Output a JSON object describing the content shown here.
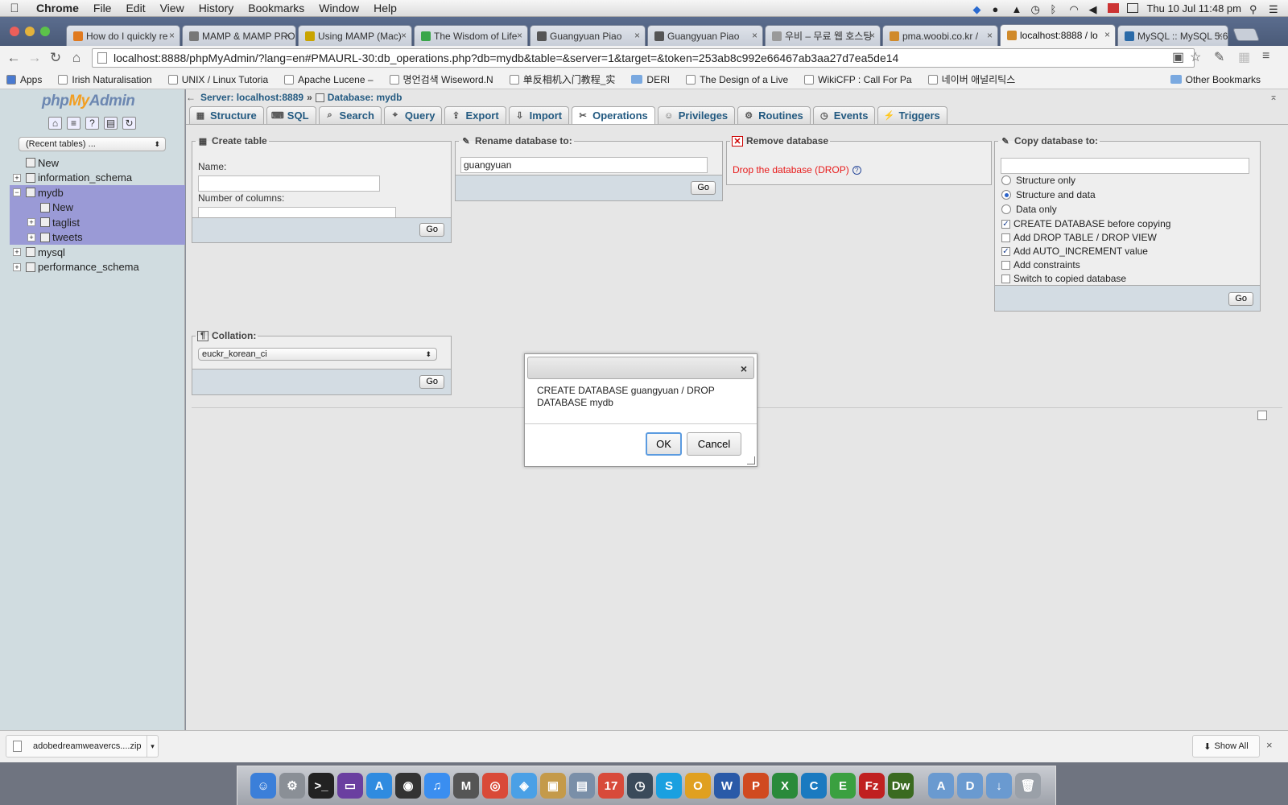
{
  "menubar": {
    "items": [
      "Chrome",
      "File",
      "Edit",
      "View",
      "History",
      "Bookmarks",
      "Window",
      "Help"
    ],
    "clock": "Thu 10 Jul  11:48 pm"
  },
  "tabs": [
    {
      "label": "How do I quickly re",
      "fav": "#e07a1f"
    },
    {
      "label": "MAMP & MAMP PRO",
      "fav": "#777"
    },
    {
      "label": "Using MAMP (Mac)",
      "fav": "#c9a400"
    },
    {
      "label": "The Wisdom of Life",
      "fav": "#3aa64a"
    },
    {
      "label": "Guangyuan Piao",
      "fav": "#555"
    },
    {
      "label": "Guangyuan Piao",
      "fav": "#555"
    },
    {
      "label": "우비 – 무료 웹 호스팅",
      "fav": "#999"
    },
    {
      "label": "pma.woobi.co.kr / ",
      "fav": "#d08a2a"
    },
    {
      "label": "localhost:8888 / lo",
      "fav": "#d08a2a"
    },
    {
      "label": "MySQL :: MySQL 5.6",
      "fav": "#2a6aa8"
    }
  ],
  "url": "localhost:8888/phpMyAdmin/?lang=en#PMAURL-30:db_operations.php?db=mydb&table=&server=1&target=&token=253ab8c992e66467ab3aa27d7ea5de14",
  "bookmarks": [
    {
      "label": "Apps",
      "kind": "apps"
    },
    {
      "label": "Irish Naturalisation ",
      "kind": "page"
    },
    {
      "label": "UNIX / Linux Tutoria",
      "kind": "page"
    },
    {
      "label": "Apache Lucene – ",
      "kind": "page"
    },
    {
      "label": "명언검색 Wiseword.N",
      "kind": "page"
    },
    {
      "label": "单反相机入门教程_实",
      "kind": "page"
    },
    {
      "label": "DERI",
      "kind": "folder"
    },
    {
      "label": "The Design of a Live",
      "kind": "page"
    },
    {
      "label": "WikiCFP : Call For Pa",
      "kind": "page"
    },
    {
      "label": "네이버 애널리틱스",
      "kind": "page"
    }
  ],
  "bookmarks_other": "Other Bookmarks",
  "pma": {
    "logo_php": "php",
    "logo_my": "My",
    "logo_admin": "Admin",
    "recent": "(Recent tables) ...",
    "tree": [
      {
        "label": "New",
        "level": 0,
        "sel": false,
        "exp": ""
      },
      {
        "label": "information_schema",
        "level": 0,
        "sel": false,
        "exp": "+"
      },
      {
        "label": "mydb",
        "level": 0,
        "sel": true,
        "exp": "−"
      },
      {
        "label": "New",
        "level": 1,
        "sel": true,
        "exp": ""
      },
      {
        "label": "taglist",
        "level": 1,
        "sel": true,
        "exp": "+"
      },
      {
        "label": "tweets",
        "level": 1,
        "sel": true,
        "exp": "+"
      },
      {
        "label": "mysql",
        "level": 0,
        "sel": false,
        "exp": "+"
      },
      {
        "label": "performance_schema",
        "level": 0,
        "sel": false,
        "exp": "+"
      }
    ],
    "breadcrumb_server": "Server: localhost:8889",
    "breadcrumb_sep": "»",
    "breadcrumb_db": "Database: mydb",
    "menu": [
      "Structure",
      "SQL",
      "Search",
      "Query",
      "Export",
      "Import",
      "Operations",
      "Privileges",
      "Routines",
      "Events",
      "Triggers"
    ],
    "active_menu": "Operations",
    "create_table": {
      "legend": "Create table",
      "name_label": "Name:",
      "cols_label": "Number of columns:",
      "go": "Go"
    },
    "rename": {
      "legend": "Rename database to:",
      "value": "guangyuan",
      "go": "Go"
    },
    "remove": {
      "legend": "Remove database",
      "drop_link": "Drop the database (DROP)"
    },
    "copy": {
      "legend": "Copy database to:",
      "radios": [
        {
          "label": "Structure only",
          "checked": false
        },
        {
          "label": "Structure and data",
          "checked": true
        },
        {
          "label": "Data only",
          "checked": false
        }
      ],
      "checks": [
        {
          "label": "CREATE DATABASE before copying",
          "checked": true
        },
        {
          "label": "Add DROP TABLE / DROP VIEW",
          "checked": false
        },
        {
          "label": "Add AUTO_INCREMENT value",
          "checked": true
        },
        {
          "label": "Add constraints",
          "checked": false
        },
        {
          "label": "Switch to copied database",
          "checked": false
        }
      ],
      "go": "Go"
    },
    "collation": {
      "legend": "Collation:",
      "value": "euckr_korean_ci",
      "go": "Go"
    }
  },
  "dialog": {
    "close": "×",
    "message": "CREATE DATABASE guangyuan / DROP DATABASE mydb",
    "ok": "OK",
    "cancel": "Cancel"
  },
  "downloads": {
    "file": "adobedreamweavercs....zip",
    "show_all": "Show All",
    "close": "×"
  },
  "dock": [
    {
      "name": "finder",
      "color": "#3b7fd9",
      "glyph": "☺"
    },
    {
      "name": "system-preferences",
      "color": "#8a8f96",
      "glyph": "⚙"
    },
    {
      "name": "terminal",
      "color": "#222",
      "glyph": ">_"
    },
    {
      "name": "mission-control",
      "color": "#6a3fa0",
      "glyph": "▭"
    },
    {
      "name": "app-store",
      "color": "#2f8be0",
      "glyph": "A"
    },
    {
      "name": "dashboard",
      "color": "#333",
      "glyph": "◉"
    },
    {
      "name": "itunes",
      "color": "#3a8ef0",
      "glyph": "♫"
    },
    {
      "name": "mamp",
      "color": "#555",
      "glyph": "M"
    },
    {
      "name": "chrome",
      "color": "#d94a38",
      "glyph": "◎"
    },
    {
      "name": "safari",
      "color": "#4aa0e6",
      "glyph": "◈"
    },
    {
      "name": "preview",
      "color": "#c49a4a",
      "glyph": "▣"
    },
    {
      "name": "photos",
      "color": "#7a8fa8",
      "glyph": "▤"
    },
    {
      "name": "calendar",
      "color": "#d84a3a",
      "glyph": "17"
    },
    {
      "name": "time-machine",
      "color": "#3a4a5a",
      "glyph": "◷"
    },
    {
      "name": "skype",
      "color": "#1aa0e0",
      "glyph": "S"
    },
    {
      "name": "outlook",
      "color": "#e0a020",
      "glyph": "O"
    },
    {
      "name": "word",
      "color": "#2a5aa8",
      "glyph": "W"
    },
    {
      "name": "powerpoint",
      "color": "#d04a20",
      "glyph": "P"
    },
    {
      "name": "excel",
      "color": "#2a8a3a",
      "glyph": "X"
    },
    {
      "name": "ccleaner",
      "color": "#1a7ac0",
      "glyph": "C"
    },
    {
      "name": "evernote",
      "color": "#3aa040",
      "glyph": "E"
    },
    {
      "name": "filezilla",
      "color": "#c02020",
      "glyph": "Fz"
    },
    {
      "name": "dreamweaver",
      "color": "#3a6a20",
      "glyph": "Dw"
    },
    {
      "name": "applications-folder",
      "color": "#6a9ad0",
      "glyph": "A"
    },
    {
      "name": "documents-folder",
      "color": "#6a9ad0",
      "glyph": "D"
    },
    {
      "name": "downloads-folder",
      "color": "#6a9ad0",
      "glyph": "↓"
    },
    {
      "name": "trash",
      "color": "#9aa0a8",
      "glyph": "🗑"
    }
  ]
}
